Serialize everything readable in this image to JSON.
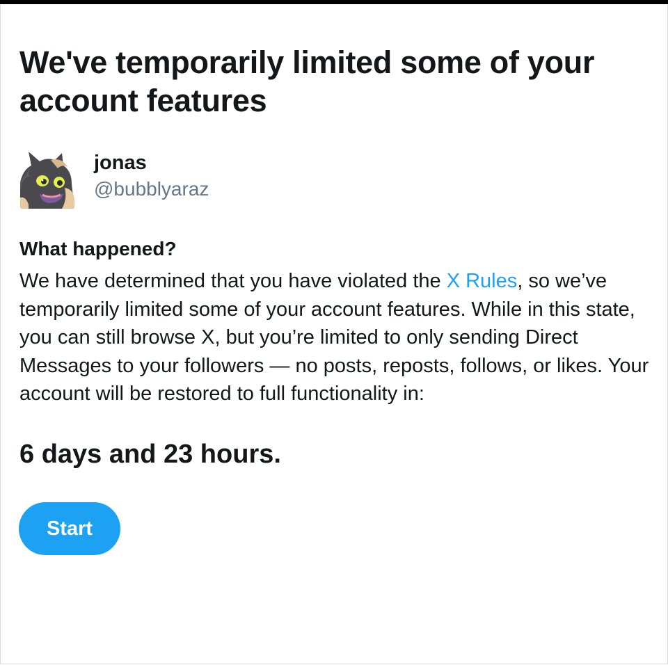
{
  "page": {
    "title": "We've temporarily limited some of your account features"
  },
  "account": {
    "display_name": "jonas",
    "handle": "@bubblyaraz",
    "avatar_icon": "cat-avatar-icon"
  },
  "notice": {
    "heading": "What happened?",
    "text_before_link": "We have determined that you have violated the ",
    "link_label": "X Rules",
    "text_after_link": ", so we’ve temporarily limited some of your account features. While in this state, you can still browse X, but you’re limited to only sending Direct Messages to your followers — no posts, reposts, follows, or likes. Your account will be restored to full functionality in:",
    "countdown": "6 days and 23 hours."
  },
  "actions": {
    "start_label": "Start"
  },
  "colors": {
    "accent": "#1da1f2",
    "text": "#14171a",
    "muted": "#657786"
  }
}
